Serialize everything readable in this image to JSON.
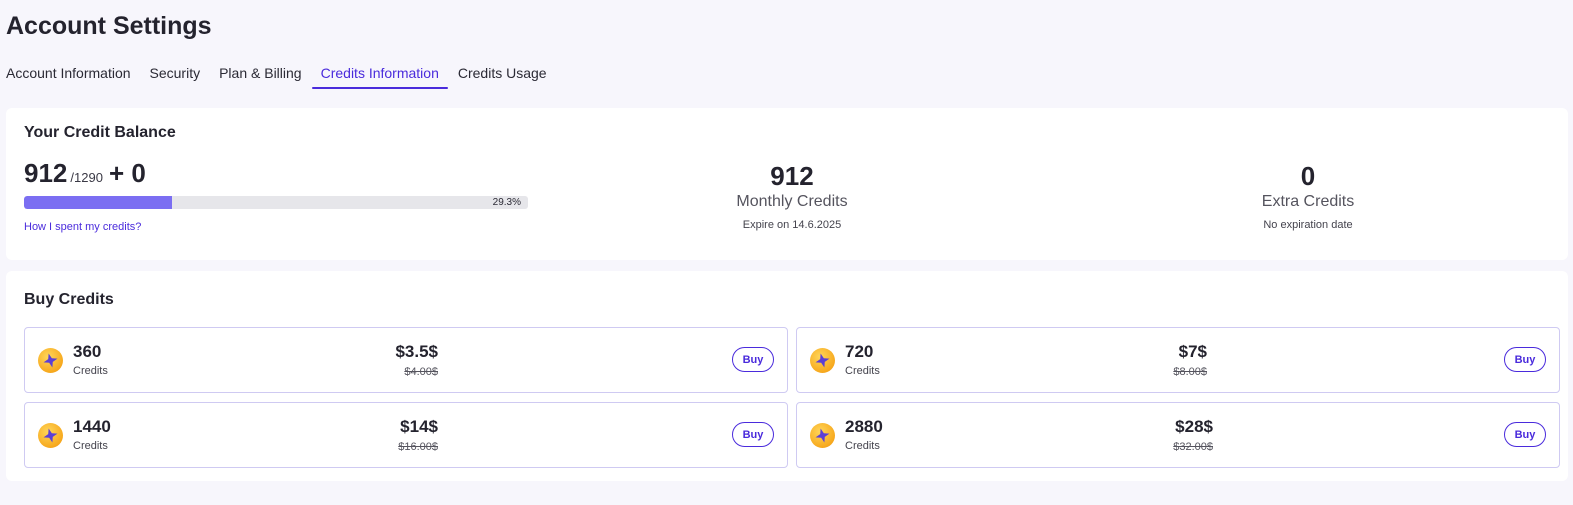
{
  "page": {
    "title": "Account Settings"
  },
  "tabs": [
    {
      "label": "Account Information"
    },
    {
      "label": "Security"
    },
    {
      "label": "Plan & Billing"
    },
    {
      "label": "Credits Information"
    },
    {
      "label": "Credits Usage"
    }
  ],
  "active_tab": "Credits Information",
  "balance": {
    "title": "Your Credit Balance",
    "current": "912",
    "total": "/1290",
    "extra": "+ 0",
    "progress_percent": 29.3,
    "progress_label": "29.3%",
    "spent_link": "How I spent my credits?",
    "monthly": {
      "value": "912",
      "label": "Monthly Credits",
      "sub": "Expire on 14.6.2025"
    },
    "extra_credits": {
      "value": "0",
      "label": "Extra Credits",
      "sub": "No expiration date"
    }
  },
  "buy": {
    "title": "Buy Credits",
    "packs": [
      {
        "amount": "360",
        "unit": "Credits",
        "price": "$3.5$",
        "old_price": "$4.00$",
        "button": "Buy"
      },
      {
        "amount": "720",
        "unit": "Credits",
        "price": "$7$",
        "old_price": "$8.00$",
        "button": "Buy"
      },
      {
        "amount": "1440",
        "unit": "Credits",
        "price": "$14$",
        "old_price": "$16.00$",
        "button": "Buy"
      },
      {
        "amount": "2880",
        "unit": "Credits",
        "price": "$28$",
        "old_price": "$32.00$",
        "button": "Buy"
      }
    ]
  },
  "colors": {
    "accent": "#4a2bdc",
    "progress_fill": "#7b6ef2",
    "coin": "#f7a91e",
    "coin_star": "#5b3fd6"
  },
  "icons": {
    "coin": "star-coin-icon"
  }
}
